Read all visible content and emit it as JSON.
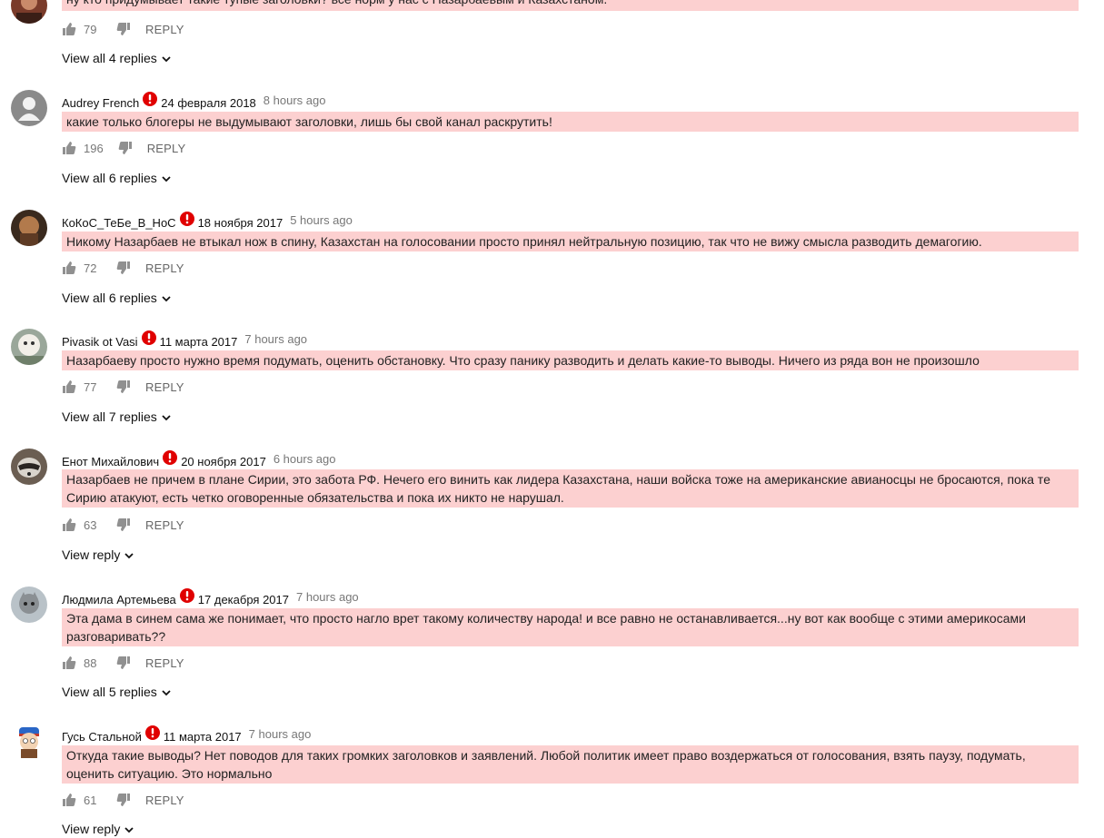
{
  "colors": {
    "highlight": "#fcd0d0",
    "warning": "#e00000",
    "muted": "#777777"
  },
  "icons": {
    "like": "thumbs-up-icon",
    "dislike": "thumbs-down-icon",
    "warning": "exclamation-icon",
    "expand": "chevron-down-icon"
  },
  "comments": [
    {
      "author": "",
      "date": "",
      "ago": "",
      "text": "ну кто придумывает такие тупые заголовки? все норм у нас с Назарбаевым и Казахстаном.",
      "likes": "79",
      "reply_label": "REPLY",
      "view_replies": "View all 4 replies"
    },
    {
      "author": "Audrey French",
      "date": "24 февраля 2018",
      "ago": "8 hours ago",
      "text": "какие только блогеры не выдумывают заголовки, лишь бы свой канал раскрутить!",
      "likes": "196",
      "reply_label": "REPLY",
      "view_replies": "View all 6 replies"
    },
    {
      "author": "КоКоС_ТеБе_В_НоС",
      "date": "18 ноября 2017",
      "ago": "5 hours ago",
      "text": "Никому Назарбаев не втыкал нож в спину, Казахстан на голосовании просто принял нейтральную позицию, так что не вижу смысла разводить демагогию.",
      "likes": "72",
      "reply_label": "REPLY",
      "view_replies": "View all 6 replies"
    },
    {
      "author": "Pivasik ot Vasi",
      "date": "11 марта 2017",
      "ago": "7 hours ago",
      "text": "Назарбаеву просто нужно время подумать, оценить обстановку. Что сразу панику разводить и делать какие-то выводы. Ничего из ряда вон не произошло",
      "likes": "77",
      "reply_label": "REPLY",
      "view_replies": "View all 7 replies"
    },
    {
      "author": "Енот Михайлович",
      "date": "20 ноября 2017",
      "ago": "6 hours ago",
      "text": "Назарбаев не причем в плане Сирии, это забота РФ. Нечего его винить как лидера Казахстана, наши войска тоже на американские авианосцы не бросаются, пока те Сирию атакуют, есть четко оговоренные обязательства и пока их никто не нарушал.",
      "likes": "63",
      "reply_label": "REPLY",
      "view_replies": "View reply"
    },
    {
      "author": "Людмила Артемьева",
      "date": "17 декабря 2017",
      "ago": "7 hours ago",
      "text": "Эта дама в синем сама же понимает, что просто нагло врет такому количеству народа! и все равно не останавливается...ну вот как вообще с этими америкосами разговаривать??",
      "likes": "88",
      "reply_label": "REPLY",
      "view_replies": "View all 5 replies"
    },
    {
      "author": "Гусь Стальной",
      "date": "11 марта 2017",
      "ago": "7 hours ago",
      "text": "Откуда такие выводы? Нет поводов для таких громких заголовков и заявлений. Любой политик имеет право воздержаться от голосования, взять паузу, подумать, оценить ситуацию. Это нормально",
      "likes": "61",
      "reply_label": "REPLY",
      "view_replies": "View reply"
    }
  ]
}
